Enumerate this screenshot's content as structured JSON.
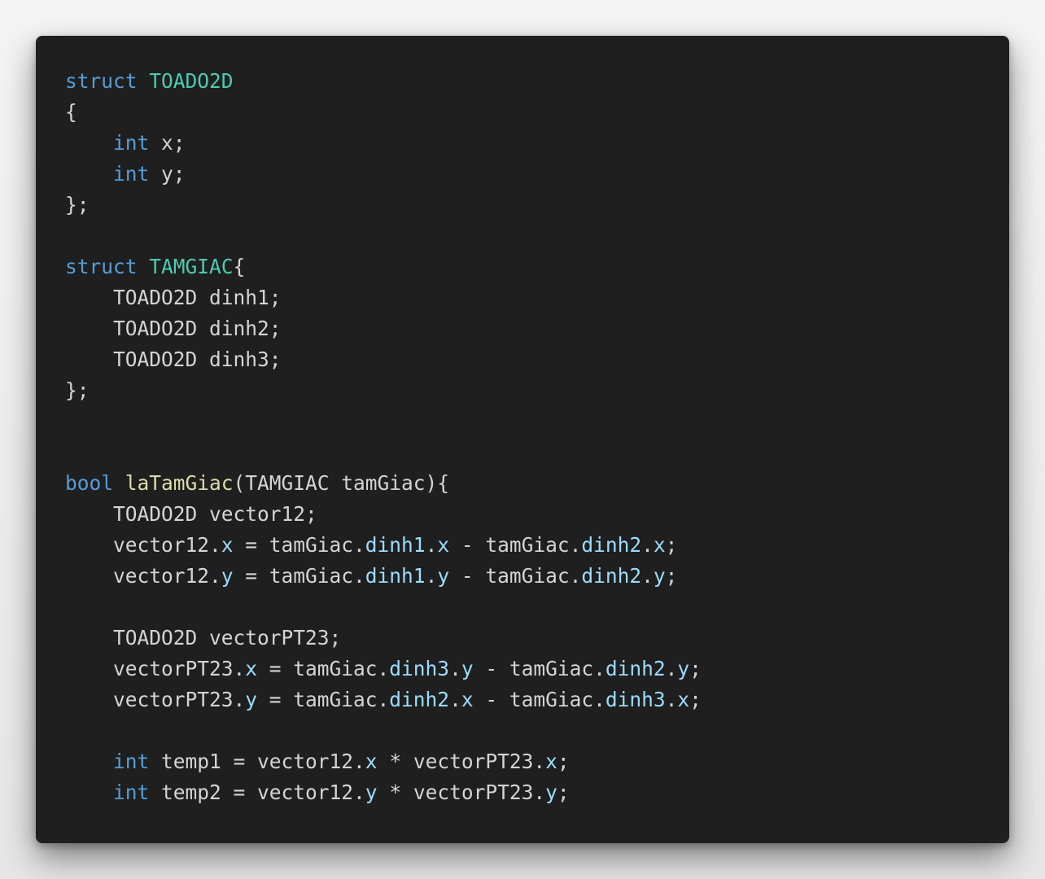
{
  "colors": {
    "background": "#1f1f1f",
    "keyword": "#569cd6",
    "type": "#4ec9b0",
    "function": "#dcdcaa",
    "property": "#9cdcfe",
    "text": "#d4d4d4"
  },
  "lines": [
    [
      {
        "t": "struct",
        "c": "keyword"
      },
      {
        "t": " ",
        "c": "plain"
      },
      {
        "t": "TOADO2D",
        "c": "type"
      }
    ],
    [
      {
        "t": "{",
        "c": "plain"
      }
    ],
    [
      {
        "t": "    ",
        "c": "plain"
      },
      {
        "t": "int",
        "c": "keyword"
      },
      {
        "t": " x;",
        "c": "plain"
      }
    ],
    [
      {
        "t": "    ",
        "c": "plain"
      },
      {
        "t": "int",
        "c": "keyword"
      },
      {
        "t": " y;",
        "c": "plain"
      }
    ],
    [
      {
        "t": "};",
        "c": "plain"
      }
    ],
    [],
    [
      {
        "t": "struct",
        "c": "keyword"
      },
      {
        "t": " ",
        "c": "plain"
      },
      {
        "t": "TAMGIAC",
        "c": "type"
      },
      {
        "t": "{",
        "c": "plain"
      }
    ],
    [
      {
        "t": "    TOADO2D dinh1;",
        "c": "plain"
      }
    ],
    [
      {
        "t": "    TOADO2D dinh2;",
        "c": "plain"
      }
    ],
    [
      {
        "t": "    TOADO2D dinh3;",
        "c": "plain"
      }
    ],
    [
      {
        "t": "};",
        "c": "plain"
      }
    ],
    [],
    [],
    [
      {
        "t": "bool",
        "c": "keyword"
      },
      {
        "t": " ",
        "c": "plain"
      },
      {
        "t": "laTamGiac",
        "c": "func"
      },
      {
        "t": "(TAMGIAC tamGiac){",
        "c": "plain"
      }
    ],
    [
      {
        "t": "    TOADO2D vector12;",
        "c": "plain"
      }
    ],
    [
      {
        "t": "    vector12.",
        "c": "plain"
      },
      {
        "t": "x",
        "c": "prop"
      },
      {
        "t": " = tamGiac.",
        "c": "plain"
      },
      {
        "t": "dinh1",
        "c": "prop"
      },
      {
        "t": ".",
        "c": "plain"
      },
      {
        "t": "x",
        "c": "prop"
      },
      {
        "t": " - tamGiac.",
        "c": "plain"
      },
      {
        "t": "dinh2",
        "c": "prop"
      },
      {
        "t": ".",
        "c": "plain"
      },
      {
        "t": "x",
        "c": "prop"
      },
      {
        "t": ";",
        "c": "plain"
      }
    ],
    [
      {
        "t": "    vector12.",
        "c": "plain"
      },
      {
        "t": "y",
        "c": "prop"
      },
      {
        "t": " = tamGiac.",
        "c": "plain"
      },
      {
        "t": "dinh1",
        "c": "prop"
      },
      {
        "t": ".",
        "c": "plain"
      },
      {
        "t": "y",
        "c": "prop"
      },
      {
        "t": " - tamGiac.",
        "c": "plain"
      },
      {
        "t": "dinh2",
        "c": "prop"
      },
      {
        "t": ".",
        "c": "plain"
      },
      {
        "t": "y",
        "c": "prop"
      },
      {
        "t": ";",
        "c": "plain"
      }
    ],
    [],
    [
      {
        "t": "    TOADO2D vectorPT23;",
        "c": "plain"
      }
    ],
    [
      {
        "t": "    vectorPT23.",
        "c": "plain"
      },
      {
        "t": "x",
        "c": "prop"
      },
      {
        "t": " = tamGiac.",
        "c": "plain"
      },
      {
        "t": "dinh3",
        "c": "prop"
      },
      {
        "t": ".",
        "c": "plain"
      },
      {
        "t": "y",
        "c": "prop"
      },
      {
        "t": " - tamGiac.",
        "c": "plain"
      },
      {
        "t": "dinh2",
        "c": "prop"
      },
      {
        "t": ".",
        "c": "plain"
      },
      {
        "t": "y",
        "c": "prop"
      },
      {
        "t": ";",
        "c": "plain"
      }
    ],
    [
      {
        "t": "    vectorPT23.",
        "c": "plain"
      },
      {
        "t": "y",
        "c": "prop"
      },
      {
        "t": " = tamGiac.",
        "c": "plain"
      },
      {
        "t": "dinh2",
        "c": "prop"
      },
      {
        "t": ".",
        "c": "plain"
      },
      {
        "t": "x",
        "c": "prop"
      },
      {
        "t": " - tamGiac.",
        "c": "plain"
      },
      {
        "t": "dinh3",
        "c": "prop"
      },
      {
        "t": ".",
        "c": "plain"
      },
      {
        "t": "x",
        "c": "prop"
      },
      {
        "t": ";",
        "c": "plain"
      }
    ],
    [],
    [
      {
        "t": "    ",
        "c": "plain"
      },
      {
        "t": "int",
        "c": "keyword"
      },
      {
        "t": " temp1 = vector12.",
        "c": "plain"
      },
      {
        "t": "x",
        "c": "prop"
      },
      {
        "t": " * vectorPT23.",
        "c": "plain"
      },
      {
        "t": "x",
        "c": "prop"
      },
      {
        "t": ";",
        "c": "plain"
      }
    ],
    [
      {
        "t": "    ",
        "c": "plain"
      },
      {
        "t": "int",
        "c": "keyword"
      },
      {
        "t": " temp2 = vector12.",
        "c": "plain"
      },
      {
        "t": "y",
        "c": "prop"
      },
      {
        "t": " * vectorPT23.",
        "c": "plain"
      },
      {
        "t": "y",
        "c": "prop"
      },
      {
        "t": ";",
        "c": "plain"
      }
    ]
  ]
}
